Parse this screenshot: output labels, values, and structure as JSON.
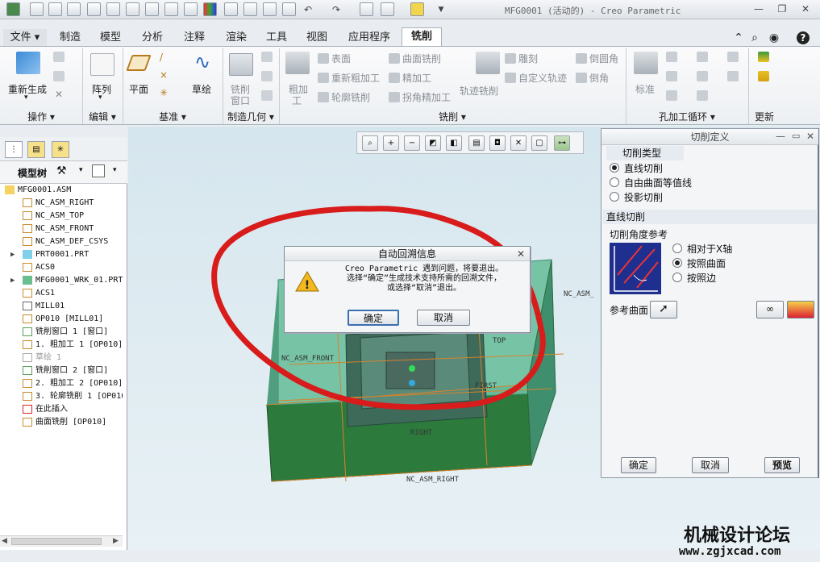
{
  "window": {
    "title": "MFG0001 (活动的) - Creo Parametric"
  },
  "tabs": [
    {
      "label": "文件",
      "has_menu": true
    },
    {
      "label": "制造"
    },
    {
      "label": "模型"
    },
    {
      "label": "分析"
    },
    {
      "label": "注释"
    },
    {
      "label": "渲染"
    },
    {
      "label": "工具"
    },
    {
      "label": "视图"
    },
    {
      "label": "应用程序"
    },
    {
      "label": "铣削",
      "active": true
    }
  ],
  "ribbon": {
    "groups": [
      {
        "label": "操作",
        "buttons": [
          "重新生成"
        ]
      },
      {
        "label": "编辑",
        "buttons": [
          "阵列"
        ]
      },
      {
        "label": "基准",
        "buttons": [
          "平面",
          "草绘"
        ]
      },
      {
        "label": "制造几何",
        "buttons": [
          "铣削窗口"
        ]
      },
      {
        "label": "铣削",
        "buttons": [
          "粗加工",
          "表面",
          "重新粗加工",
          "轮廓铣削",
          "曲面铣削",
          "精加工",
          "拐角精加工",
          "轨迹铣削",
          "雕刻",
          "自定义轨迹",
          "倒圆角",
          "倒角"
        ]
      },
      {
        "label": "孔加工循环",
        "buttons": [
          "标准"
        ]
      },
      {
        "label": "更新",
        "buttons": []
      }
    ],
    "labels": {
      "regen": "重新生成",
      "pattern": "阵列",
      "plane": "平面",
      "sketch": "草绘",
      "millwin1": "铣削",
      "millwin2": "窗口",
      "rough1": "粗加",
      "rough2": "工",
      "face": "表面",
      "rerough": "重新粗加工",
      "profile": "轮廓铣削",
      "surface": "曲面铣削",
      "finish": "精加工",
      "corner": "拐角精加工",
      "traj": "轨迹铣削",
      "engrave": "雕刻",
      "custom": "自定义轨迹",
      "round": "倒圆角",
      "chamfer": "倒角",
      "standard": "标准"
    },
    "group_labels": {
      "ops": "操作",
      "edit": "编辑",
      "datum": "基准",
      "mfggeo": "制造几何",
      "mill": "铣削",
      "hole": "孔加工循环",
      "update": "更新"
    }
  },
  "model_tree": {
    "header": "模型树",
    "items": [
      {
        "text": "MFG0001.ASM",
        "indent": 0,
        "icon": "assembly"
      },
      {
        "text": "NC_ASM_RIGHT",
        "indent": 1,
        "icon": "datum-plane"
      },
      {
        "text": "NC_ASM_TOP",
        "indent": 1,
        "icon": "datum-plane"
      },
      {
        "text": "NC_ASM_FRONT",
        "indent": 1,
        "icon": "datum-plane"
      },
      {
        "text": "NC_ASM_DEF_CSYS",
        "indent": 1,
        "icon": "csys"
      },
      {
        "text": "PRT0001.PRT",
        "indent": 1,
        "icon": "part",
        "expand": true
      },
      {
        "text": "ACS0",
        "indent": 1,
        "icon": "csys"
      },
      {
        "text": "MFG0001_WRK_01.PRT",
        "indent": 1,
        "icon": "workpiece",
        "expand": true
      },
      {
        "text": "ACS1",
        "indent": 1,
        "icon": "csys"
      },
      {
        "text": "MILL01",
        "indent": 1,
        "icon": "workcell"
      },
      {
        "text": "OP010 [MILL01]",
        "indent": 1,
        "icon": "operation"
      },
      {
        "text": "铣削窗口 1 [窗口]",
        "indent": 1,
        "icon": "mill-window"
      },
      {
        "text": "1. 粗加工 1 [OP010]",
        "indent": 1,
        "icon": "sequence"
      },
      {
        "text": "草绘 1",
        "indent": 1,
        "icon": "sketch",
        "grey": true
      },
      {
        "text": "铣削窗口 2 [窗口]",
        "indent": 1,
        "icon": "mill-window"
      },
      {
        "text": "2. 粗加工 2 [OP010]",
        "indent": 1,
        "icon": "sequence"
      },
      {
        "text": "3. 轮廓铣削 1 [OP010]",
        "indent": 1,
        "icon": "sequence"
      },
      {
        "text": "在此插入",
        "indent": 1,
        "icon": "insert-arrow"
      },
      {
        "text": "曲面铣削 [OP010]",
        "indent": 1,
        "icon": "sequence-active"
      }
    ]
  },
  "viewport_labels": {
    "nc_asm": "NC_ASM_",
    "asm_front": "NC_ASM_FRONT",
    "top": "TOP",
    "right": "RIGHT",
    "asm_right": "NC_ASM_RIGHT",
    "first": "FIRST"
  },
  "cut_panel": {
    "title": "切削定义",
    "cut_type_label": "切削类型",
    "cut_types": [
      {
        "label": "直线切削",
        "selected": true
      },
      {
        "label": "自由曲面等值线",
        "selected": false
      },
      {
        "label": "投影切削",
        "selected": false
      }
    ],
    "straight_section": "直线切削",
    "angle_ref_label": "切削角度参考",
    "angle_refs": [
      {
        "label": "相对于X轴",
        "selected": false
      },
      {
        "label": "按照曲面",
        "selected": true
      },
      {
        "label": "按照边",
        "selected": false
      }
    ],
    "ref_surface_label": "参考曲面",
    "ok": "确定",
    "cancel": "取消",
    "preview": "预览"
  },
  "dialog": {
    "title": "自动回溯信息",
    "message_lines": [
      "Creo Parametric 遇到问题，将要退出。",
      "选择“确定”生成技术支持所需的回溯文件，",
      "或选择“取消”退出。"
    ],
    "ok": "确定",
    "cancel": "取消"
  },
  "watermark": {
    "line1": "机械设计论坛",
    "line2": "www.zgjxcad.com"
  },
  "colors": {
    "annotation": "#d81b1b",
    "model": "#5fb79a",
    "model_dark": "#2d6b3a",
    "datum": "#d9822b"
  }
}
